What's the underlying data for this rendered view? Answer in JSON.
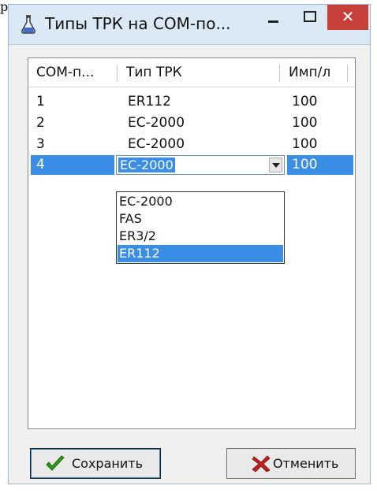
{
  "window": {
    "title": "Типы ТРК на COM-по...",
    "close_glyph": "✕"
  },
  "corner_mark": "р",
  "list": {
    "columns": [
      "COM-п...",
      "Тип ТРК",
      "Имп/л"
    ],
    "rows": [
      {
        "port": "1",
        "type": "ER112",
        "imp": "100"
      },
      {
        "port": "2",
        "type": "EC-2000",
        "imp": "100"
      },
      {
        "port": "3",
        "type": "EC-2000",
        "imp": "100"
      },
      {
        "port": "4",
        "type": "EC-2000",
        "imp": "100"
      }
    ],
    "selected_row": 4,
    "dropdown_options": [
      "EC-2000",
      "FAS",
      "ER3/2",
      "ER112"
    ],
    "highlighted_option": "ER112"
  },
  "buttons": {
    "save_label": "Сохранить",
    "cancel_label": "Отменить"
  },
  "icons": {
    "app": "flask-icon",
    "save": "checkmark-icon",
    "cancel": "x-icon"
  },
  "colors": {
    "selection": "#3a8ee6",
    "close_button": "#c7403a",
    "titlebar": "#dbe8f6",
    "checkmark": "#2e9a1a",
    "cancel_x": "#c0201c"
  }
}
